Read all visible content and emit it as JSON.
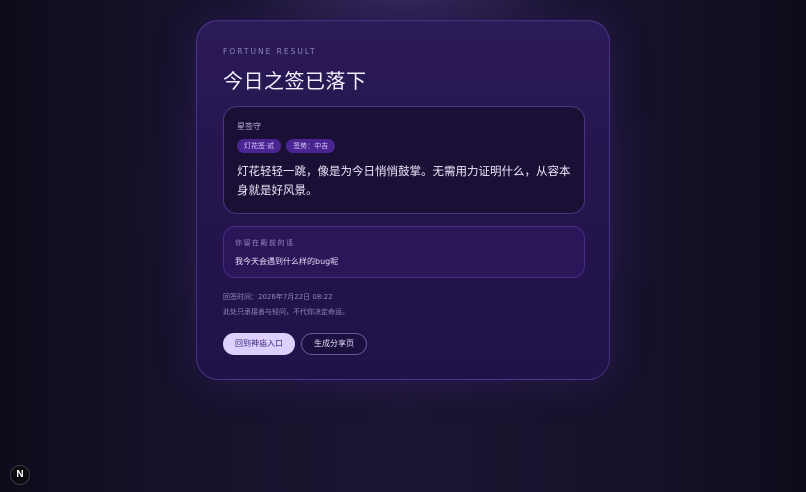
{
  "header": {
    "eyebrow": "FORTUNE RESULT",
    "title": "今日之签已落下"
  },
  "fortune": {
    "guardian": "星签守",
    "tags": [
      "灯花签·贰",
      "签势：中吉"
    ],
    "text": "灯花轻轻一跳，像是为今日悄悄鼓掌。无需用力证明什么，从容本身就是好风景。"
  },
  "question": {
    "label": "你留在殿前的话",
    "text": "我今天会遇到什么样的bug呢"
  },
  "meta": {
    "time": "回签时间：2026年7月22日 08:22",
    "note": "此处只承接善与轻问，不代你决定命运。"
  },
  "actions": {
    "back_label": "回到神庙入口",
    "share_label": "生成分享页"
  },
  "badge": {
    "letter": "N",
    "icon": "nextjs-logo-icon"
  },
  "colors": {
    "accent": "#ddd0ff",
    "tag_bg": "#4a2591",
    "card_bg": "#24154c"
  }
}
